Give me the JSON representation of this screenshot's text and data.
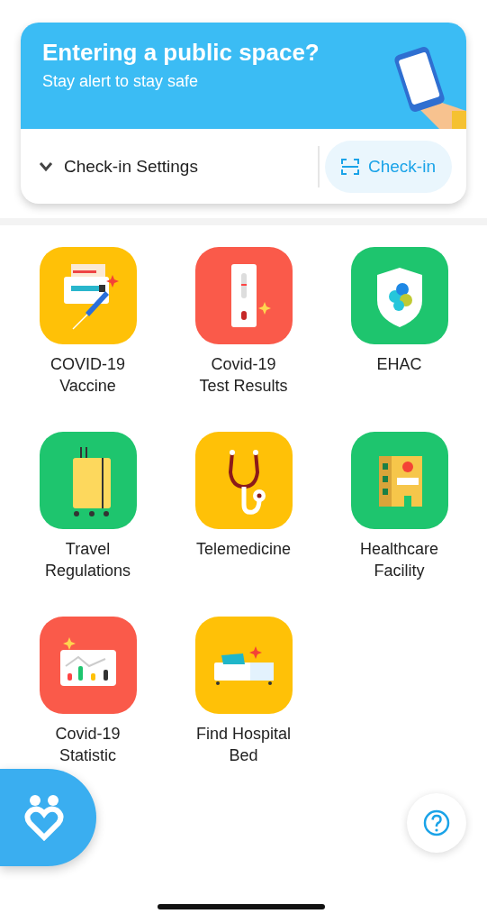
{
  "banner": {
    "title": "Entering a public space?",
    "subtitle": "Stay alert to stay safe"
  },
  "checkin": {
    "settings_label": "Check-in Settings",
    "button_label": "Check-in"
  },
  "menu": [
    {
      "label": "COVID-19\nVaccine",
      "kind": "vaccine",
      "color": "#ffc107"
    },
    {
      "label": "Covid-19\nTest Results",
      "kind": "test",
      "color": "#fa5a4a"
    },
    {
      "label": "EHAC",
      "kind": "shield",
      "color": "#1ec56e"
    },
    {
      "label": "Travel\nRegulations",
      "kind": "luggage",
      "color": "#1ec56e"
    },
    {
      "label": "Telemedicine",
      "kind": "stethoscope",
      "color": "#ffc107"
    },
    {
      "label": "Healthcare\nFacility",
      "kind": "hospital",
      "color": "#1ec56e"
    },
    {
      "label": "Covid-19\nStatistic",
      "kind": "statistic",
      "color": "#fa5a4a"
    },
    {
      "label": "Find Hospital\nBed",
      "kind": "bed",
      "color": "#ffc107"
    }
  ]
}
